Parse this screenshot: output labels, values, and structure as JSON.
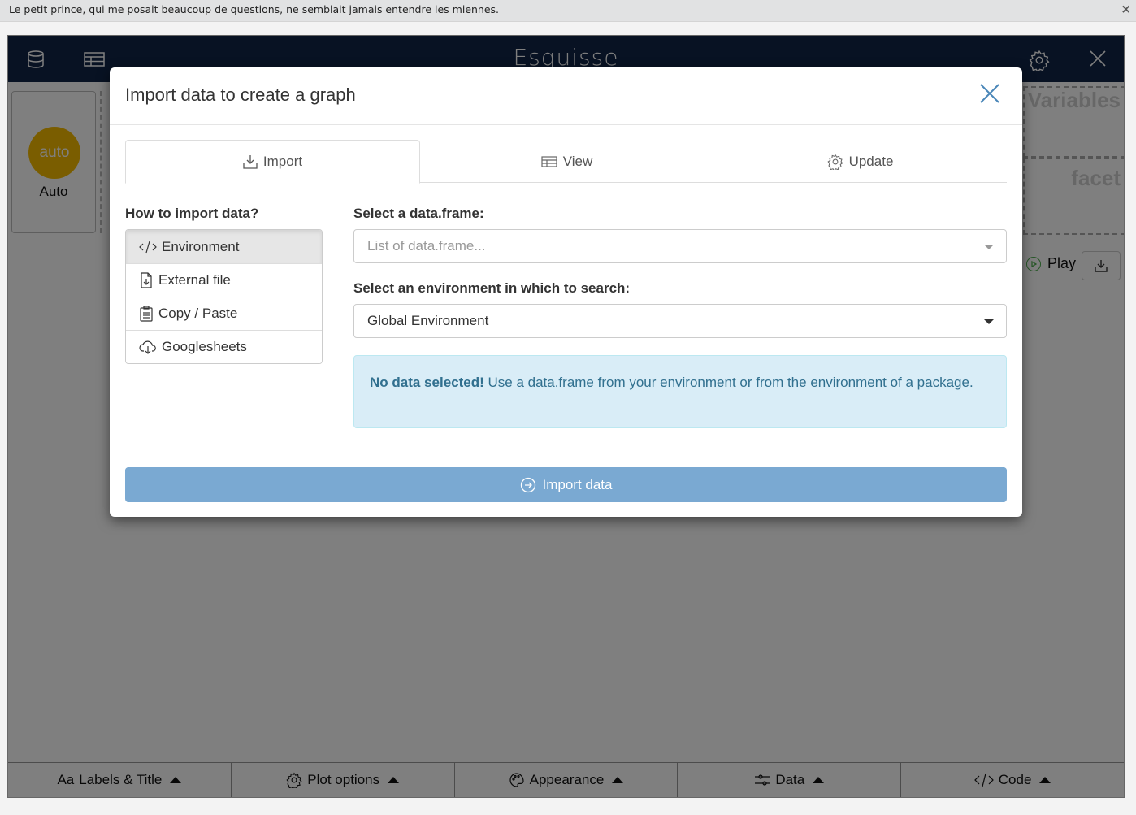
{
  "banner": {
    "text": "Le petit prince, qui me posait beaucoup de questions, ne semblait jamais entendre les miennes.",
    "close_label": "×"
  },
  "app": {
    "title": "Esquisse",
    "icons": [
      "database-icon",
      "table-icon",
      "gear-icon",
      "close-icon"
    ],
    "geom": {
      "circle_label": "auto",
      "label": "Auto",
      "color": "#F5BB00"
    },
    "dropzones": [
      {
        "label": "Variables"
      },
      {
        "label": "facet"
      }
    ],
    "play_label": "Play",
    "bottom_tabs": [
      {
        "icon": "font-icon",
        "icon_text": "Aa",
        "label": "Labels & Title"
      },
      {
        "icon": "gear-icon",
        "label": "Plot options"
      },
      {
        "icon": "palette-icon",
        "label": "Appearance"
      },
      {
        "icon": "sliders-icon",
        "label": "Data"
      },
      {
        "icon": "code-icon",
        "label": "Code"
      }
    ]
  },
  "modal": {
    "title": "Import data to create a graph",
    "tabs": [
      {
        "label": "Import",
        "icon": "download-icon",
        "active": true
      },
      {
        "label": "View",
        "icon": "table-icon",
        "active": false
      },
      {
        "label": "Update",
        "icon": "gear-icon",
        "active": false
      }
    ],
    "how_label": "How to import data?",
    "methods": [
      {
        "label": "Environment",
        "icon": "code-icon",
        "active": true
      },
      {
        "label": "External file",
        "icon": "file-import-icon",
        "active": false
      },
      {
        "label": "Copy / Paste",
        "icon": "clipboard-icon",
        "active": false
      },
      {
        "label": "Googlesheets",
        "icon": "cloud-download-icon",
        "active": false
      }
    ],
    "dataframe_label": "Select a data.frame:",
    "dataframe_placeholder": "List of data.frame...",
    "env_label": "Select an environment in which to search:",
    "env_value": "Global Environment",
    "alert": {
      "strong": "No data selected!",
      "text": " Use a data.frame from your environment or from the environment of a package."
    },
    "import_button": "Import data"
  },
  "colors": {
    "navbar": "#112446",
    "import_button": "#7aa9d2",
    "alert_bg": "#d9edf7",
    "alert_text": "#31708f",
    "close_x": "#4a86b8"
  }
}
